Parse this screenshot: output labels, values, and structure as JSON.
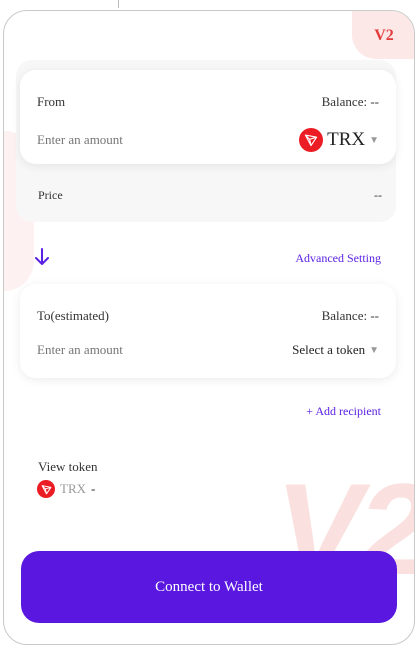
{
  "badge": {
    "version": "V2"
  },
  "watermark": "V2",
  "from": {
    "label": "From",
    "balance": "Balance: --",
    "placeholder": "Enter an amount",
    "token": "TRX",
    "token_icon": "tron-icon"
  },
  "price": {
    "label": "Price",
    "value": "--"
  },
  "switch_icon": "arrow-down-icon",
  "advanced_setting": "Advanced Setting",
  "to": {
    "label": "To(estimated)",
    "balance": "Balance: --",
    "placeholder": "Enter an amount",
    "select_token": "Select a token"
  },
  "add_recipient": "+ Add recipient",
  "view_token": {
    "label": "View token",
    "token": "TRX",
    "value": "-"
  },
  "connect_button": "Connect to Wallet",
  "colors": {
    "accent": "#5a17e0",
    "tron_red": "#ec1c24",
    "badge_bg": "#fde8e8"
  }
}
